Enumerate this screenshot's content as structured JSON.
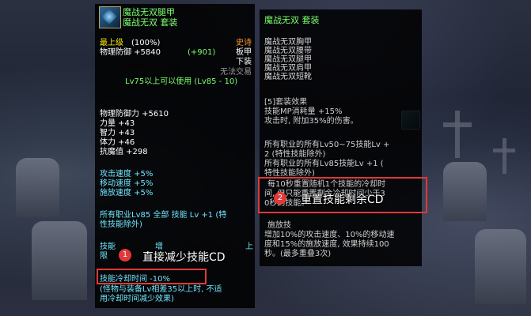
{
  "left_tooltip": {
    "item_name": "魔战无双腿甲",
    "set_name": "魔战无双   套装",
    "grade": "最上级",
    "grade_pct": "(100%)",
    "rarity": "史诗",
    "phys_def": "物理防御 +5840",
    "phys_def_bonus": "(+901)",
    "armor_type": "板甲",
    "slot": "下装",
    "trade": "无法交易",
    "level_req": "Lv75以上可以使用  (Lv85 - 10)",
    "stats": [
      "物理防御力 +5610",
      "力量 +43",
      "智力 +43",
      "体力 +46",
      "抗魔值 +298"
    ],
    "speeds": [
      "攻击速度 +5%",
      "移动速度 +5%",
      "施放速度 +5%"
    ],
    "skill_line1": "所有职业Lv85 全部 技能 Lv +1 (特",
    "skill_line2": "性技能除外)",
    "partial_text_a": "技能",
    "partial_text_b": "增",
    "partial_text_c": "上",
    "partial_text_d": "限",
    "cd_text": "技能冷却时间 -10%",
    "cd_note_line1": "(怪物与装备Lv相差35以上时, 不适",
    "cd_note_line2": "用冷却时间减少效果)"
  },
  "right_tooltip": {
    "title": "魔战无双   套装",
    "set_items": [
      "魔战无双胸甲",
      "魔战无双腰带",
      "魔战无双腿甲",
      "魔战无双肩甲",
      "魔战无双短靴"
    ],
    "set_effect_header": "[5]套装效果",
    "effect_lines": [
      "技能MP消耗量 +15%",
      "  攻击时, 附加35%的伤害。"
    ],
    "all_job_lines": [
      "所有职业的所有Lv50~75技能Lv +",
      "2 (特性技能除外)",
      "所有职业的所有Lv85技能Lv +1 (",
      "特性技能除外)"
    ],
    "reset_lines": [
      "每10秒重置随机1个技能的冷却时",
      "间, 但只能重置剩余冷却时间少于3",
      "0秒的技能。"
    ],
    "bottom_partial": "施放技",
    "bottom_lines": [
      "增加10%的攻击速度、10%的移动速",
      "度和15%的施放速度, 效果持续100",
      "秒。(最多重叠3次)"
    ]
  },
  "annotations": {
    "badge1": "1",
    "label1": "直接减少技能CD",
    "badge2": "2",
    "label2": "重置技能剩余CD"
  },
  "colors": {
    "highlight_box": "#e23838",
    "item_name": "#7cff6b",
    "grade": "#ffea00",
    "rarity": "#ff9a2a"
  }
}
